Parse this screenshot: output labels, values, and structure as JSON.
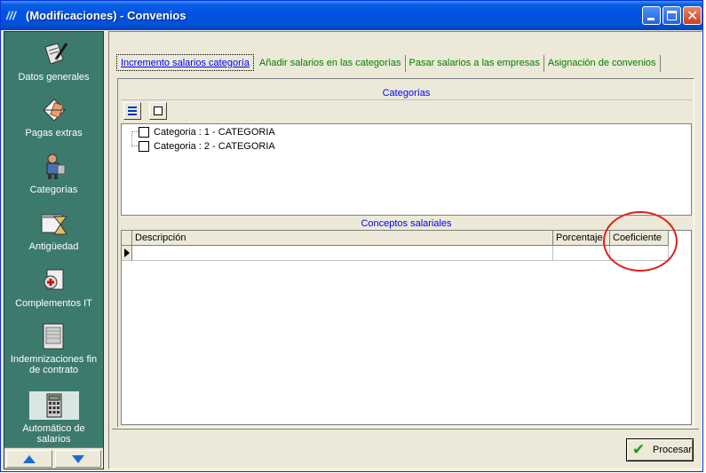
{
  "window": {
    "title_icon": "///",
    "title": "(Modificaciones) - Convenios"
  },
  "sidebar": {
    "items": [
      {
        "label": "Datos generales",
        "icon": "pen-document-icon"
      },
      {
        "label": "Pagas extras",
        "icon": "envelope-money-icon"
      },
      {
        "label": "Categorías",
        "icon": "worker-icon"
      },
      {
        "label": "Antigüedad",
        "icon": "hourglass-calendar-icon"
      },
      {
        "label": "Complementos IT",
        "icon": "medical-kit-icon"
      },
      {
        "label": "Indemnizaciones fin de contrato",
        "icon": "documents-stack-icon"
      },
      {
        "label": "Automático de salarios",
        "icon": "calculator-icon"
      }
    ]
  },
  "tabs": [
    {
      "label": "Incremento salarios categoría",
      "active": true
    },
    {
      "label": "Añadir salarios en las categorías",
      "active": false
    },
    {
      "label": "Pasar salarios a las empresas",
      "active": false
    },
    {
      "label": "Asignación de convenios",
      "active": false
    }
  ],
  "categories": {
    "header": "Categorías",
    "items": [
      {
        "label": "Categoria : 1 - CATEGORIA",
        "checked": false
      },
      {
        "label": "Categoria : 2 - CATEGORIA",
        "checked": false
      }
    ]
  },
  "concepts": {
    "header": "Conceptos salariales",
    "columns": [
      "Descripción",
      "Porcentaje",
      "Coeficiente"
    ],
    "rows": [
      {
        "descripcion": "",
        "porcentaje": "",
        "coeficiente": ""
      }
    ]
  },
  "actions": {
    "process_label": "Procesar"
  },
  "colors": {
    "sidebar_bg": "#3d7a6e",
    "active_tab": "#0000ff",
    "inactive_tab": "#008000",
    "highlight_circle": "#e0201a"
  }
}
